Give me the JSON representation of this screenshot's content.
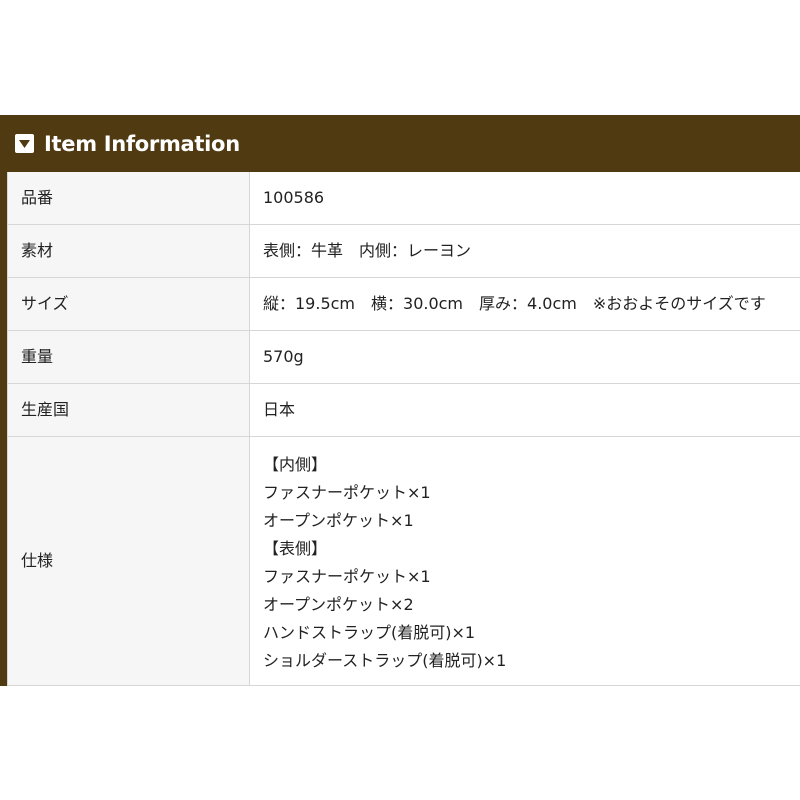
{
  "section": {
    "title": "Item Information",
    "toggle_icon": "caret-down-icon",
    "colors": {
      "header_background": "#4f3a12",
      "label_background": "#f6f6f6",
      "border": "#d6d6d6"
    }
  },
  "specs": [
    {
      "label": "品番",
      "value": "100586"
    },
    {
      "label": "素材",
      "value": "表側：牛革　内側：レーヨン"
    },
    {
      "label": "サイズ",
      "value": "縦：19.5cm　横：30.0cm　厚み：4.0cm　※おおよそのサイズです"
    },
    {
      "label": "重量",
      "value": "570g"
    },
    {
      "label": "生産国",
      "value": "日本"
    }
  ],
  "features": {
    "label": "仕様",
    "lines": [
      "【内側】",
      "ファスナーポケット×1",
      "オープンポケット×1",
      "【表側】",
      "ファスナーポケット×1",
      "オープンポケット×2",
      "ハンドストラップ(着脱可)×1",
      "ショルダーストラップ(着脱可)×1"
    ]
  }
}
